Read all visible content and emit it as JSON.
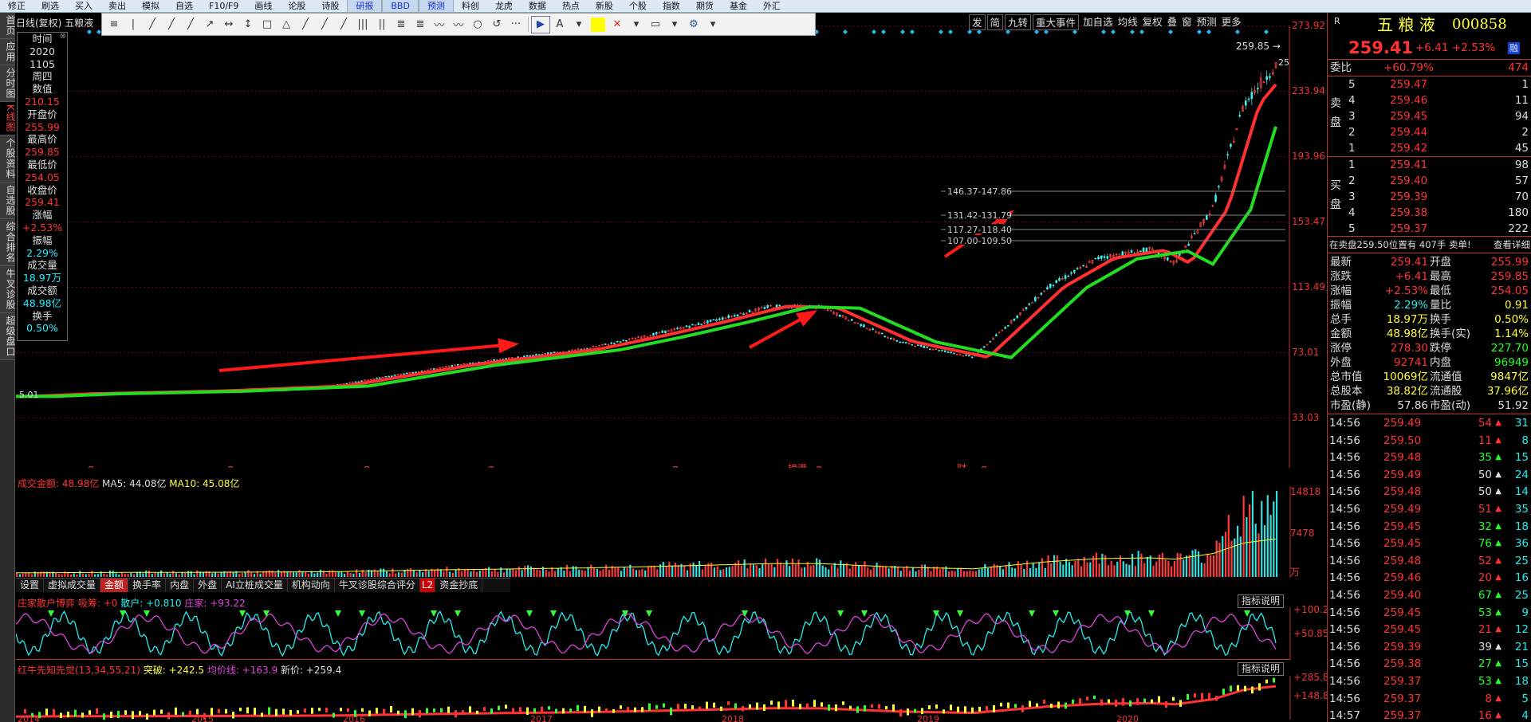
{
  "topbar": {
    "items": [
      "修正",
      "刷选",
      "买入",
      "卖出",
      "模拟",
      "自选",
      "F10/F9",
      "画线",
      "论股",
      "诗股",
      "研报",
      "BBD",
      "预测",
      "料创",
      "龙虎",
      "数据",
      "热点",
      "新股",
      "个股",
      "指数",
      "期货",
      "基金",
      "外汇"
    ]
  },
  "lefttabs": [
    "首页",
    "应用",
    "分时图",
    "K线图",
    "个股资料",
    "自选股",
    "综合排名",
    "牛叉诊股",
    "超级盘口"
  ],
  "chart": {
    "title": "日线(复权) 五粮液",
    "tooltip": {
      "time_label": "时间",
      "year": "2020",
      "date": "1105",
      "weekday": "周四",
      "value_label": "数值",
      "value": "210.15",
      "open_label": "开盘价",
      "open": "255.99",
      "high_label": "最高价",
      "high": "259.85",
      "low_label": "最低价",
      "low": "254.05",
      "close_label": "收盘价",
      "close": "259.41",
      "chg_label": "涨幅",
      "chg": "+2.53%",
      "amp_label": "振幅",
      "amp": "2.29%",
      "vol_label": "成交量",
      "vol": "18.97万",
      "amt_label": "成交额",
      "amt": "48.98亿",
      "turn_label": "换手",
      "turn": "0.50%",
      "close_btn": "⊗"
    },
    "controls": [
      "发",
      "简",
      "九转",
      "重大事件",
      "加自选",
      "均线",
      "复权",
      "叠",
      "窗",
      "预测",
      "更多"
    ],
    "price_axis": [
      "273.92",
      "233.94",
      "193.96",
      "153.47",
      "113.49",
      "73.01",
      "33.03"
    ],
    "high_marker": "259.85",
    "high_tail": "25",
    "low_marker": "5.01",
    "annotations": [
      "146.37-147.86",
      "131.42-131.79",
      "117.27-118.40",
      "107.00-109.50"
    ],
    "event_marks": [
      "q",
      "q",
      "q",
      "q",
      "q",
      "榜港",
      "q",
      "财",
      "q"
    ],
    "vol_legend": {
      "label": "成交金额: 48.98亿",
      "ma5": "MA5: 44.08亿",
      "ma10": "MA10: 45.08亿"
    },
    "vol_axis": [
      "14818",
      "7478",
      "万"
    ],
    "subtabs": [
      "设置",
      "虚拟成交量",
      "金额",
      "换手率",
      "内盘",
      "外盘",
      "AI立桩成交量",
      "机构动向",
      "牛叉诊股综合评分",
      "L2",
      "资金抄底"
    ],
    "ind1": {
      "label": "庄家散户博弈",
      "a": "吸筹: +0",
      "b": "散户: +0.810",
      "c": "庄家: +93.22",
      "axis": [
        "+100.2",
        "+50.85"
      ],
      "btn": "指标说明"
    },
    "ind2": {
      "label": "红牛先知先觉(13,34,55,21)",
      "a": "突破: +242.5",
      "b": "均价线: +163.9",
      "c": "新价: +259.4",
      "axis": [
        "+285.8",
        "+148.8"
      ],
      "btn": "指标说明"
    },
    "years": [
      "2014",
      "2015",
      "2016",
      "2017",
      "2018",
      "2019",
      "2020"
    ]
  },
  "quote": {
    "r_label": "R",
    "name": "五 粮 液",
    "code": "000858",
    "price": "259.41",
    "change": "+6.41",
    "pct": "+2.53%",
    "flag": "融",
    "webi_label": "委比",
    "webi": "+60.79%",
    "webi_v": "474",
    "sell_label": "卖盘",
    "buy_label": "买盘",
    "asks": [
      {
        "n": "5",
        "p": "259.47",
        "v": "1"
      },
      {
        "n": "4",
        "p": "259.46",
        "v": "11"
      },
      {
        "n": "3",
        "p": "259.45",
        "v": "94"
      },
      {
        "n": "2",
        "p": "259.44",
        "v": "2"
      },
      {
        "n": "1",
        "p": "259.42",
        "v": "45"
      }
    ],
    "bids": [
      {
        "n": "1",
        "p": "259.41",
        "v": "98"
      },
      {
        "n": "2",
        "p": "259.40",
        "v": "57"
      },
      {
        "n": "3",
        "p": "259.39",
        "v": "70"
      },
      {
        "n": "4",
        "p": "259.38",
        "v": "180"
      },
      {
        "n": "5",
        "p": "259.37",
        "v": "222"
      }
    ],
    "notice": "在卖盘259.50位置有 407手 卖单!",
    "detail": "查看详细",
    "stats": [
      [
        "最新",
        "259.41",
        "开盘",
        "255.99"
      ],
      [
        "涨跌",
        "+6.41",
        "最高",
        "259.85"
      ],
      [
        "涨幅",
        "+2.53%",
        "最低",
        "254.05"
      ],
      [
        "振幅",
        "2.29%",
        "量比",
        "0.91"
      ],
      [
        "总手",
        "18.97万",
        "换手",
        "0.50%"
      ],
      [
        "金额",
        "48.98亿",
        "换手(实)",
        "1.14%"
      ],
      [
        "涨停",
        "278.30",
        "跌停",
        "227.70"
      ],
      [
        "外盘",
        "92741",
        "内盘",
        "96949"
      ],
      [
        "总市值",
        "10069亿",
        "流通值",
        "9847亿"
      ],
      [
        "总股本",
        "38.82亿",
        "流通股",
        "37.96亿"
      ],
      [
        "市盈(静)",
        "57.86",
        "市盈(动)",
        "51.92"
      ]
    ],
    "ticks": [
      [
        "14:56",
        "259.49",
        "54",
        "31"
      ],
      [
        "14:56",
        "259.50",
        "11",
        "8"
      ],
      [
        "14:56",
        "259.48",
        "35",
        "15"
      ],
      [
        "14:56",
        "259.49",
        "50",
        "24"
      ],
      [
        "14:56",
        "259.48",
        "50",
        "14"
      ],
      [
        "14:56",
        "259.49",
        "51",
        "35"
      ],
      [
        "14:56",
        "259.45",
        "32",
        "18"
      ],
      [
        "14:56",
        "259.45",
        "76",
        "36"
      ],
      [
        "14:56",
        "259.48",
        "52",
        "25"
      ],
      [
        "14:56",
        "259.46",
        "20",
        "16"
      ],
      [
        "14:56",
        "259.40",
        "67",
        "25"
      ],
      [
        "14:56",
        "259.45",
        "53",
        "9"
      ],
      [
        "14:56",
        "259.45",
        "21",
        "12"
      ],
      [
        "14:56",
        "259.39",
        "39",
        "21"
      ],
      [
        "14:56",
        "259.38",
        "27",
        "15"
      ],
      [
        "14:56",
        "259.37",
        "53",
        "18"
      ],
      [
        "14:56",
        "259.37",
        "8",
        "5"
      ],
      [
        "14:57",
        "259.37",
        "16",
        "4"
      ]
    ]
  },
  "colors": {
    "up": "#ff3333",
    "down": "#22ff22",
    "ma_red": "#ff3333",
    "ma_green": "#22dd22",
    "cyan": "#22eeee",
    "magenta": "#dd44dd"
  }
}
